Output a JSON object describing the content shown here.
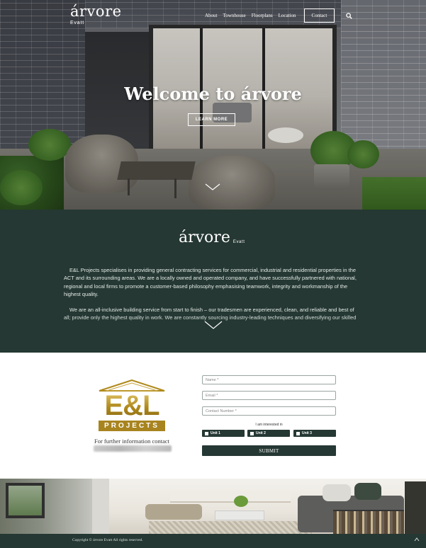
{
  "brand": {
    "name": "árvore",
    "suburb": "Evatt"
  },
  "nav": {
    "items": [
      "About",
      "Townhouse",
      "Floorplans",
      "Location"
    ],
    "contact_label": "Contact",
    "search_icon": "search-icon"
  },
  "hero": {
    "title": "Welcome to árvore",
    "cta_label": "LEARN MORE",
    "scroll_icon": "chevron-down-icon"
  },
  "about": {
    "paragraphs": [
      "E&L Projects specialises in providing general contracting services for commercial, industrial and residential properties in the ACT and its surrounding areas. We are a locally owned and operated company, and have successfully partnered with national, regional and local firms to promote a customer-based philosophy emphasising teamwork, integrity and workmanship of the highest quality.",
      "We are an all-inclusive building service from start to finish – our tradesmen are experienced, clean, and reliable and best of all; provide only the highest quality in work. We are constantly sourcing industry-leading techniques and diversifying our skilled"
    ],
    "expand_icon": "chevron-down-icon"
  },
  "contact": {
    "logo_letters": "E&L",
    "logo_bar": "PROJECTS",
    "further_info": "For further information contact",
    "form": {
      "name_placeholder": "Name *",
      "email_placeholder": "Email *",
      "phone_placeholder": "Contact Number *",
      "interest_label": "I am interested in",
      "units": [
        "Unit 1",
        "Unit 2",
        "Unit 3"
      ],
      "submit_label": "SUBMIT"
    }
  },
  "footer": {
    "copyright": "Copyright © árvore Evatt All rights reserved.",
    "top_icon": "chevron-up-icon"
  },
  "colors": {
    "brand_dark_green": "#253833",
    "gold": "#a8841f",
    "white": "#ffffff"
  }
}
